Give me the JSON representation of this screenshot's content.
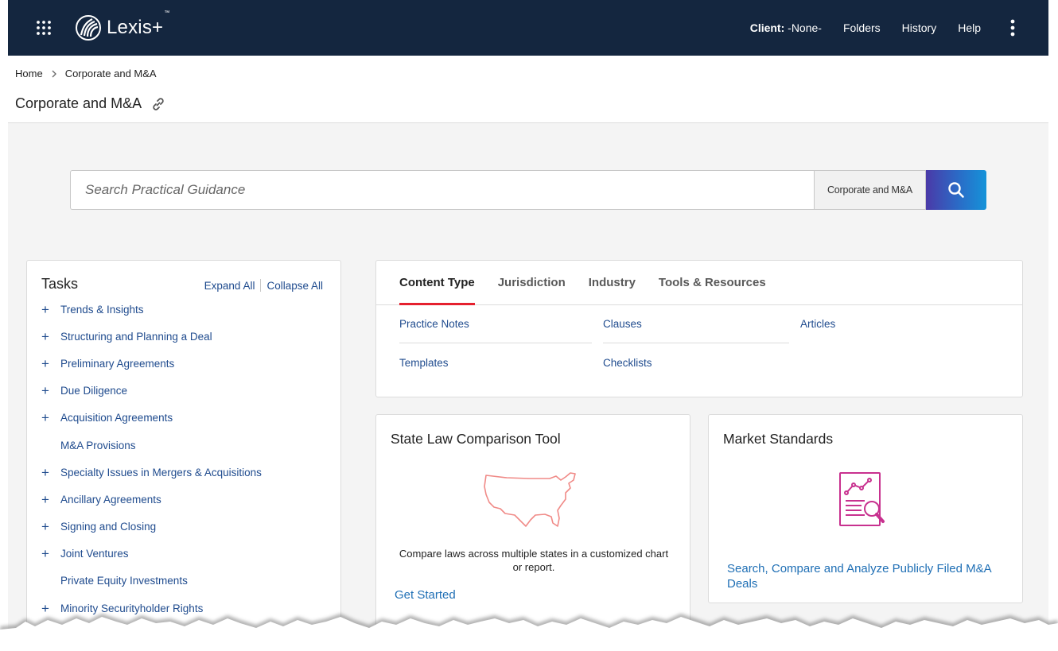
{
  "topbar": {
    "logo_text": "Lexis+",
    "logo_tm": "™",
    "client_label": "Client:",
    "client_value": " -None-",
    "folders": "Folders",
    "history": "History",
    "help": "Help",
    "icons": {
      "apps": "apps-grid-icon",
      "more": "kebab-icon"
    }
  },
  "breadcrumb": {
    "home": "Home",
    "current": "Corporate and M&A"
  },
  "page_title": "Corporate and M&A",
  "search": {
    "placeholder": "Search Practical Guidance",
    "scope": "Corporate and M&A"
  },
  "tasks": {
    "title": "Tasks",
    "expand_all": "Expand All",
    "collapse_all": "Collapse All",
    "items": [
      {
        "label": "Trends & Insights",
        "expandable": true
      },
      {
        "label": "Structuring and Planning a Deal",
        "expandable": true
      },
      {
        "label": "Preliminary Agreements",
        "expandable": true
      },
      {
        "label": "Due Diligence",
        "expandable": true
      },
      {
        "label": "Acquisition Agreements",
        "expandable": true
      },
      {
        "label": "M&A Provisions",
        "expandable": false
      },
      {
        "label": "Specialty Issues in Mergers & Acquisitions",
        "expandable": true
      },
      {
        "label": "Ancillary Agreements",
        "expandable": true
      },
      {
        "label": "Signing and Closing",
        "expandable": true
      },
      {
        "label": "Joint Ventures",
        "expandable": true
      },
      {
        "label": "Private Equity Investments",
        "expandable": false
      },
      {
        "label": "Minority Securityholder Rights",
        "expandable": true
      }
    ]
  },
  "content_type": {
    "tabs": [
      "Content Type",
      "Jurisdiction",
      "Industry",
      "Tools & Resources"
    ],
    "active_tab": "Content Type",
    "links": {
      "practice_notes": "Practice Notes",
      "clauses": "Clauses",
      "articles": "Articles",
      "templates": "Templates",
      "checklists": "Checklists"
    }
  },
  "state_law": {
    "title": "State Law Comparison Tool",
    "description": "Compare laws across multiple states in a customized chart or report.",
    "cta": "Get Started"
  },
  "market_standards": {
    "title": "Market Standards",
    "cta": "Search, Compare and Analyze Publicly Filed M&A Deals"
  },
  "colors": {
    "nav_bg": "#14263f",
    "link": "#1f4b8e",
    "accent_red": "#e5202e",
    "magenta": "#c8318f"
  }
}
